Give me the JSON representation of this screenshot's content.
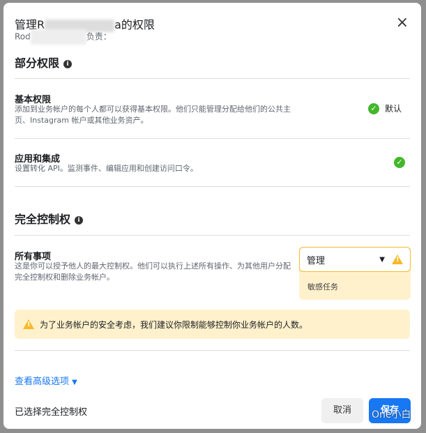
{
  "dialog": {
    "title_prefix": "管理R",
    "title_suffix": "a的权限",
    "subtitle_prefix": "Rod",
    "subtitle_suffix": "负责：",
    "close_label": "×"
  },
  "partial": {
    "heading": "部分权限",
    "items": [
      {
        "title": "基本权限",
        "desc": "添加到业务帐户的每个人都可以获得基本权限。他们只能管理分配给他们的公共主页、Instagram 帐户或其他业务资产。",
        "status": "默认"
      },
      {
        "title": "应用和集成",
        "desc": "设置转化 API。监测事件、编辑应用和创建访问口令。"
      }
    ]
  },
  "full": {
    "heading": "完全控制权",
    "item": {
      "title": "所有事项",
      "desc": "这是你可以授予他人的最大控制权。他们可以执行上述所有操作、为其他用户分配完全控制权和删除业务帐户。"
    },
    "select_value": "管理",
    "select_note": "敏感任务"
  },
  "banner": "为了业务帐户的安全考虑，我们建议你限制能够控制你业务帐户的人数。",
  "advanced_link": "查看高级选项",
  "footer": {
    "status": "已选择完全控制权",
    "cancel": "取消",
    "save": "保存",
    "watermark": "One小白"
  },
  "colors": {
    "accent": "#1877f2",
    "check": "#42b72a",
    "warning": "#f7b928",
    "warning_bg": "#fff1cc"
  }
}
